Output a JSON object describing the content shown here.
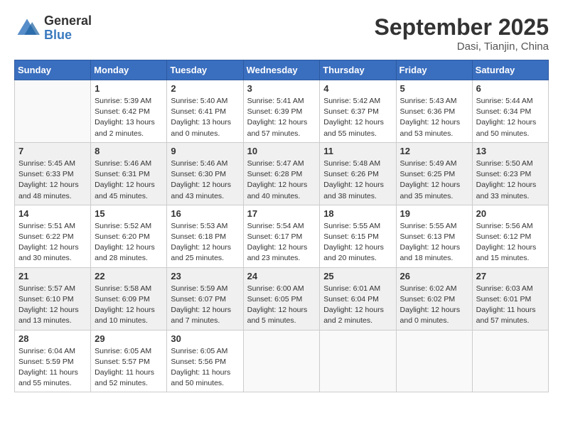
{
  "header": {
    "logo_line1": "General",
    "logo_line2": "Blue",
    "month": "September 2025",
    "location": "Dasi, Tianjin, China"
  },
  "days_of_week": [
    "Sunday",
    "Monday",
    "Tuesday",
    "Wednesday",
    "Thursday",
    "Friday",
    "Saturday"
  ],
  "weeks": [
    {
      "shaded": false,
      "days": [
        {
          "empty": true
        },
        {
          "num": "1",
          "sunrise": "5:39 AM",
          "sunset": "6:42 PM",
          "daylight": "13 hours and 2 minutes."
        },
        {
          "num": "2",
          "sunrise": "5:40 AM",
          "sunset": "6:41 PM",
          "daylight": "13 hours and 0 minutes."
        },
        {
          "num": "3",
          "sunrise": "5:41 AM",
          "sunset": "6:39 PM",
          "daylight": "12 hours and 57 minutes."
        },
        {
          "num": "4",
          "sunrise": "5:42 AM",
          "sunset": "6:37 PM",
          "daylight": "12 hours and 55 minutes."
        },
        {
          "num": "5",
          "sunrise": "5:43 AM",
          "sunset": "6:36 PM",
          "daylight": "12 hours and 53 minutes."
        },
        {
          "num": "6",
          "sunrise": "5:44 AM",
          "sunset": "6:34 PM",
          "daylight": "12 hours and 50 minutes."
        }
      ]
    },
    {
      "shaded": true,
      "days": [
        {
          "num": "7",
          "sunrise": "5:45 AM",
          "sunset": "6:33 PM",
          "daylight": "12 hours and 48 minutes."
        },
        {
          "num": "8",
          "sunrise": "5:46 AM",
          "sunset": "6:31 PM",
          "daylight": "12 hours and 45 minutes."
        },
        {
          "num": "9",
          "sunrise": "5:46 AM",
          "sunset": "6:30 PM",
          "daylight": "12 hours and 43 minutes."
        },
        {
          "num": "10",
          "sunrise": "5:47 AM",
          "sunset": "6:28 PM",
          "daylight": "12 hours and 40 minutes."
        },
        {
          "num": "11",
          "sunrise": "5:48 AM",
          "sunset": "6:26 PM",
          "daylight": "12 hours and 38 minutes."
        },
        {
          "num": "12",
          "sunrise": "5:49 AM",
          "sunset": "6:25 PM",
          "daylight": "12 hours and 35 minutes."
        },
        {
          "num": "13",
          "sunrise": "5:50 AM",
          "sunset": "6:23 PM",
          "daylight": "12 hours and 33 minutes."
        }
      ]
    },
    {
      "shaded": false,
      "days": [
        {
          "num": "14",
          "sunrise": "5:51 AM",
          "sunset": "6:22 PM",
          "daylight": "12 hours and 30 minutes."
        },
        {
          "num": "15",
          "sunrise": "5:52 AM",
          "sunset": "6:20 PM",
          "daylight": "12 hours and 28 minutes."
        },
        {
          "num": "16",
          "sunrise": "5:53 AM",
          "sunset": "6:18 PM",
          "daylight": "12 hours and 25 minutes."
        },
        {
          "num": "17",
          "sunrise": "5:54 AM",
          "sunset": "6:17 PM",
          "daylight": "12 hours and 23 minutes."
        },
        {
          "num": "18",
          "sunrise": "5:55 AM",
          "sunset": "6:15 PM",
          "daylight": "12 hours and 20 minutes."
        },
        {
          "num": "19",
          "sunrise": "5:55 AM",
          "sunset": "6:13 PM",
          "daylight": "12 hours and 18 minutes."
        },
        {
          "num": "20",
          "sunrise": "5:56 AM",
          "sunset": "6:12 PM",
          "daylight": "12 hours and 15 minutes."
        }
      ]
    },
    {
      "shaded": true,
      "days": [
        {
          "num": "21",
          "sunrise": "5:57 AM",
          "sunset": "6:10 PM",
          "daylight": "12 hours and 13 minutes."
        },
        {
          "num": "22",
          "sunrise": "5:58 AM",
          "sunset": "6:09 PM",
          "daylight": "12 hours and 10 minutes."
        },
        {
          "num": "23",
          "sunrise": "5:59 AM",
          "sunset": "6:07 PM",
          "daylight": "12 hours and 7 minutes."
        },
        {
          "num": "24",
          "sunrise": "6:00 AM",
          "sunset": "6:05 PM",
          "daylight": "12 hours and 5 minutes."
        },
        {
          "num": "25",
          "sunrise": "6:01 AM",
          "sunset": "6:04 PM",
          "daylight": "12 hours and 2 minutes."
        },
        {
          "num": "26",
          "sunrise": "6:02 AM",
          "sunset": "6:02 PM",
          "daylight": "12 hours and 0 minutes."
        },
        {
          "num": "27",
          "sunrise": "6:03 AM",
          "sunset": "6:01 PM",
          "daylight": "11 hours and 57 minutes."
        }
      ]
    },
    {
      "shaded": false,
      "days": [
        {
          "num": "28",
          "sunrise": "6:04 AM",
          "sunset": "5:59 PM",
          "daylight": "11 hours and 55 minutes."
        },
        {
          "num": "29",
          "sunrise": "6:05 AM",
          "sunset": "5:57 PM",
          "daylight": "11 hours and 52 minutes."
        },
        {
          "num": "30",
          "sunrise": "6:05 AM",
          "sunset": "5:56 PM",
          "daylight": "11 hours and 50 minutes."
        },
        {
          "empty": true
        },
        {
          "empty": true
        },
        {
          "empty": true
        },
        {
          "empty": true
        }
      ]
    }
  ],
  "labels": {
    "sunrise_prefix": "Sunrise: ",
    "sunset_prefix": "Sunset: ",
    "daylight_prefix": "Daylight: "
  }
}
